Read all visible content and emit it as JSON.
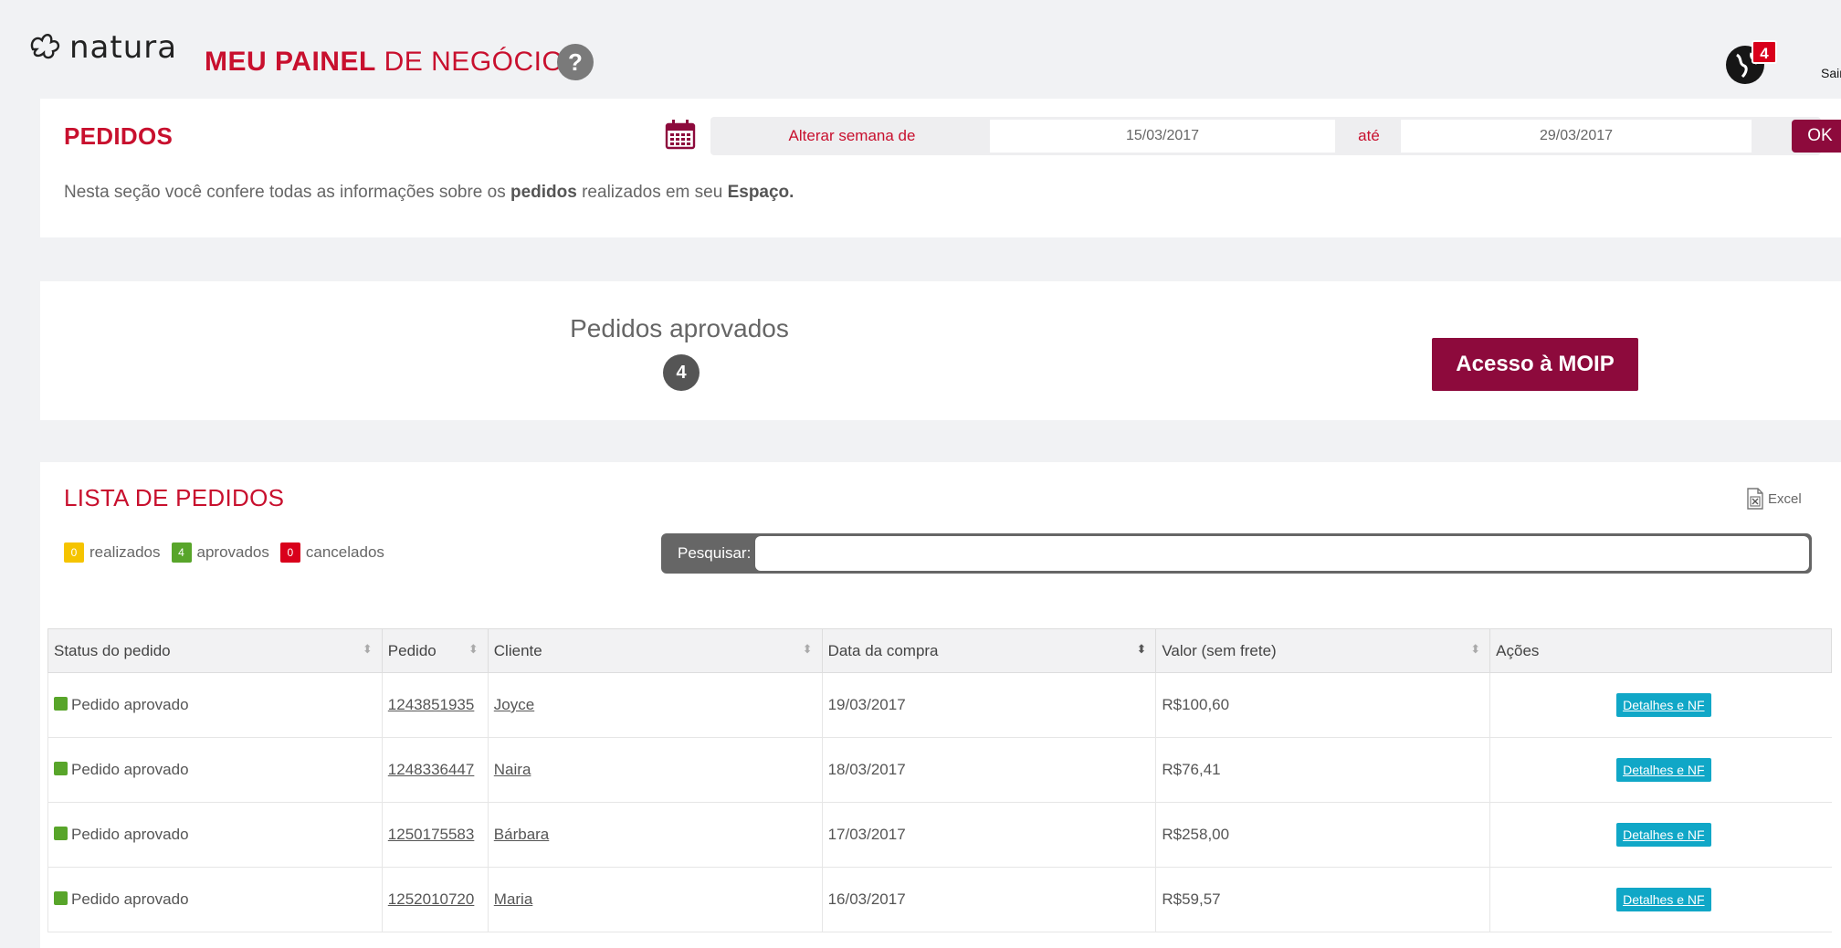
{
  "header": {
    "brand": "natura",
    "title_bold": "MEU PAINEL",
    "title_rest": " DE NEGÓCIOS",
    "help_label": "?",
    "notification_count": "4",
    "logout_label": "Sair"
  },
  "pedidos": {
    "title": "PEDIDOS",
    "desc_prefix": "Nesta seção você confere todas as informações sobre os ",
    "desc_bold1": "pedidos",
    "desc_middle": " realizados em seu ",
    "desc_bold2": "Espaço.",
    "week_label": "Alterar semana de",
    "start_date": "15/03/2017",
    "until_label": "até",
    "end_date": "29/03/2017",
    "ok_label": "OK"
  },
  "approved": {
    "label": "Pedidos aprovados",
    "count": "4",
    "moip_button": "Acesso à MOIP"
  },
  "lista": {
    "title": "LISTA DE PEDIDOS",
    "excel_label": "Excel",
    "legend": [
      {
        "count": "0",
        "label": "realizados",
        "color": "#f5c400"
      },
      {
        "count": "4",
        "label": "aprovados",
        "color": "#58a52a"
      },
      {
        "count": "0",
        "label": "cancelados",
        "color": "#d9001b"
      }
    ],
    "search_label": "Pesquisar:",
    "search_value": "",
    "columns": [
      "Status do pedido",
      "Pedido",
      "Cliente",
      "Data da compra",
      "Valor (sem frete)",
      "Ações"
    ],
    "rows": [
      {
        "status": "Pedido aprovado",
        "pedido": "1243851935",
        "cliente": "Joyce",
        "data": "19/03/2017",
        "valor": "R$100,60",
        "acao": "Detalhes e NF"
      },
      {
        "status": "Pedido aprovado",
        "pedido": "1248336447",
        "cliente": "Naira",
        "data": "18/03/2017",
        "valor": "R$76,41",
        "acao": "Detalhes e NF"
      },
      {
        "status": "Pedido aprovado",
        "pedido": "1250175583",
        "cliente": "Bárbara",
        "data": "17/03/2017",
        "valor": "R$258,00",
        "acao": "Detalhes e NF"
      },
      {
        "status": "Pedido aprovado",
        "pedido": "1252010720",
        "cliente": "Maria",
        "data": "16/03/2017",
        "valor": "R$59,57",
        "acao": "Detalhes e NF"
      }
    ]
  },
  "colors": {
    "brand_red": "#c8102e",
    "burgundy": "#8d0a3c",
    "approved_green": "#58a52a",
    "action_cyan": "#10a7c7"
  }
}
